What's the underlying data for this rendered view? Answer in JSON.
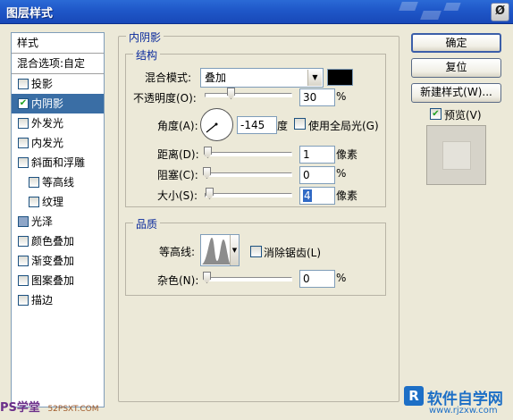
{
  "window": {
    "title": "图层样式",
    "close_glyph": "Ø"
  },
  "styles_list": {
    "header": "样式",
    "blend_options": "混合选项:自定",
    "items": [
      {
        "label": "投影",
        "checked": false
      },
      {
        "label": "内阴影",
        "checked": true,
        "selected": true
      },
      {
        "label": "外发光",
        "checked": false
      },
      {
        "label": "内发光",
        "checked": false
      },
      {
        "label": "斜面和浮雕",
        "checked": false
      },
      {
        "label": "等高线",
        "checked": false,
        "sub": true
      },
      {
        "label": "纹理",
        "checked": false,
        "sub": true
      },
      {
        "label": "光泽",
        "checked": false
      },
      {
        "label": "颜色叠加",
        "checked": false
      },
      {
        "label": "渐变叠加",
        "checked": false
      },
      {
        "label": "图案叠加",
        "checked": false
      },
      {
        "label": "描边",
        "checked": false
      }
    ]
  },
  "inner_shadow": {
    "panel_title": "内阴影",
    "structure": {
      "title": "结构",
      "blend_mode_label": "混合模式:",
      "blend_mode_value": "叠加",
      "color": "#000000",
      "opacity_label": "不透明度(O):",
      "opacity_value": "30",
      "opacity_unit": "%",
      "angle_label": "角度(A):",
      "angle_value": "-145",
      "angle_unit": "度",
      "global_light_label": "使用全局光(G)",
      "distance_label": "距离(D):",
      "distance_value": "1",
      "distance_unit": "像素",
      "choke_label": "阻塞(C):",
      "choke_value": "0",
      "choke_unit": "%",
      "size_label": "大小(S):",
      "size_value": "4",
      "size_unit": "像素"
    },
    "quality": {
      "title": "品质",
      "contour_label": "等高线:",
      "antialias_label": "消除锯齿(L)",
      "noise_label": "杂色(N):",
      "noise_value": "0",
      "noise_unit": "%"
    }
  },
  "buttons": {
    "ok": "确定",
    "reset": "复位",
    "new_style": "新建样式(W)...",
    "preview_label": "预览(V)"
  },
  "watermarks": {
    "left": "PS学堂",
    "left_url": "52PSXT.COM",
    "right_logo": "软件自学网",
    "right_url": "www.rjzxw.com"
  }
}
